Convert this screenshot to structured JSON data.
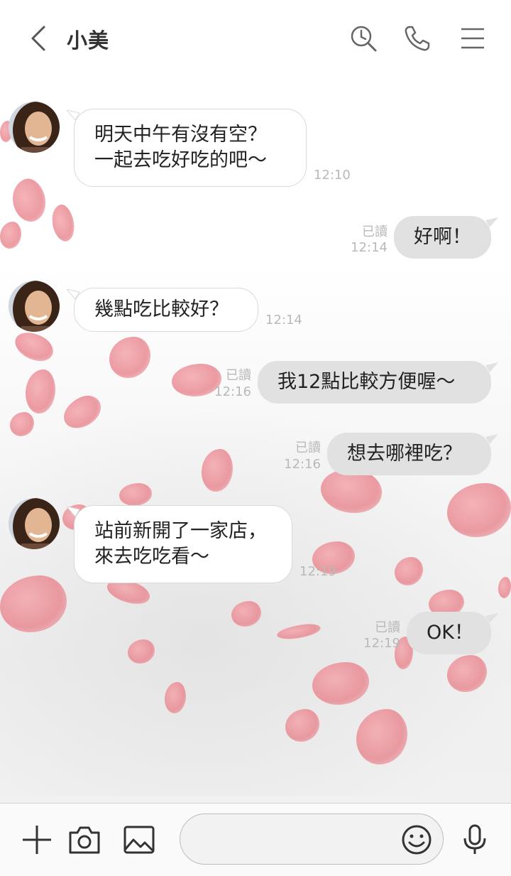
{
  "header": {
    "title": "小美",
    "icons": [
      "back-icon",
      "search-history-icon",
      "phone-icon",
      "menu-icon"
    ]
  },
  "messages": [
    {
      "side": "in",
      "lines": [
        "明天中午有沒有空？",
        "一起去吃好吃的吧～"
      ],
      "time": "12:10"
    },
    {
      "side": "out",
      "lines": [
        "好啊！"
      ],
      "read": "已讀",
      "time": "12:14"
    },
    {
      "side": "in",
      "lines": [
        "幾點吃比較好？"
      ],
      "time": "12:14"
    },
    {
      "side": "out",
      "lines": [
        "我12點比較方便喔～"
      ],
      "read": "已讀",
      "time": "12:16"
    },
    {
      "side": "out",
      "lines": [
        "想去哪裡吃？"
      ],
      "read": "已讀",
      "time": "12:16"
    },
    {
      "side": "in",
      "lines": [
        "站前新開了一家店，",
        "來去吃吃看～"
      ],
      "time": "12:19"
    },
    {
      "side": "out",
      "lines": [
        "OK！"
      ],
      "read": "已讀",
      "time": "12:19"
    }
  ],
  "footer": {
    "icons": [
      "plus-icon",
      "camera-icon",
      "image-icon",
      "emoji-icon",
      "microphone-icon"
    ],
    "input_value": "",
    "input_placeholder": ""
  },
  "colors": {
    "incoming_bubble": "#ffffff",
    "outgoing_bubble": "#e1e1e1",
    "petal": "#e88a92",
    "meta_text": "#b9b9b9"
  }
}
